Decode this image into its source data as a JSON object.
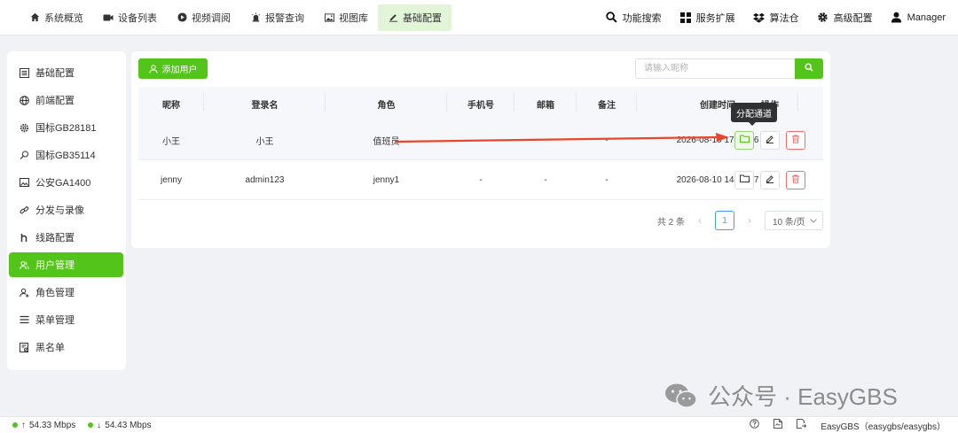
{
  "topnav": {
    "items": [
      {
        "label": "系统概览",
        "icon": "home-icon"
      },
      {
        "label": "设备列表",
        "icon": "video-camera-icon"
      },
      {
        "label": "视频调阅",
        "icon": "play-circle-icon"
      },
      {
        "label": "报警查询",
        "icon": "alarm-icon"
      },
      {
        "label": "视图库",
        "icon": "image-icon"
      },
      {
        "label": "基础配置",
        "icon": "edit-icon",
        "active": true
      }
    ],
    "right": [
      {
        "label": "功能搜索",
        "icon": "search-icon"
      },
      {
        "label": "服务扩展",
        "icon": "grid-icon"
      },
      {
        "label": "算法仓",
        "icon": "dropbox-icon"
      },
      {
        "label": "高级配置",
        "icon": "gear-icon"
      },
      {
        "label": "Manager",
        "icon": "user-icon"
      }
    ]
  },
  "sidebar": {
    "items": [
      {
        "label": "基础配置",
        "icon": "list-icon"
      },
      {
        "label": "前端配置",
        "icon": "globe-icon"
      },
      {
        "label": "国标GB28181",
        "icon": "gear-icon"
      },
      {
        "label": "国标GB35114",
        "icon": "key-icon"
      },
      {
        "label": "公安GA1400",
        "icon": "image-icon"
      },
      {
        "label": "分发与录像",
        "icon": "link-icon"
      },
      {
        "label": "线路配置",
        "icon": "route-icon"
      },
      {
        "label": "用户管理",
        "icon": "users-icon",
        "active": true
      },
      {
        "label": "角色管理",
        "icon": "user-role-icon"
      },
      {
        "label": "菜单管理",
        "icon": "menu-icon"
      },
      {
        "label": "黑名单",
        "icon": "blacklist-icon"
      }
    ]
  },
  "toolbar": {
    "add_user_label": "添加用户",
    "search_placeholder": "请输入昵称"
  },
  "table": {
    "columns": [
      "昵称",
      "登录名",
      "角色",
      "手机号",
      "邮箱",
      "备注",
      "创建时间",
      "操作"
    ],
    "rows": [
      {
        "nickname": "小王",
        "login": "小王",
        "role": "值班员",
        "phone": "-",
        "email": "-",
        "note": "-",
        "created": "2026-08-10 17:04:46"
      },
      {
        "nickname": "jenny",
        "login": "admin123",
        "role": "jenny1",
        "phone": "-",
        "email": "-",
        "note": "-",
        "created": "2026-08-10 14:16:27"
      }
    ]
  },
  "tooltip": {
    "text": "分配通道"
  },
  "pagination": {
    "total_label": "共 2 条",
    "current_page": "1",
    "page_size_label": "10 条/页"
  },
  "statusbar": {
    "upload": "54.33 Mbps",
    "download": "54.43 Mbps",
    "server_label": "EasyGBS（easygbs/easygbs）"
  },
  "watermark": {
    "text": "公众号 · EasyGBS"
  },
  "colors": {
    "accent": "#52c41a",
    "danger": "#f56c6c",
    "arrow": "#e8472d"
  }
}
